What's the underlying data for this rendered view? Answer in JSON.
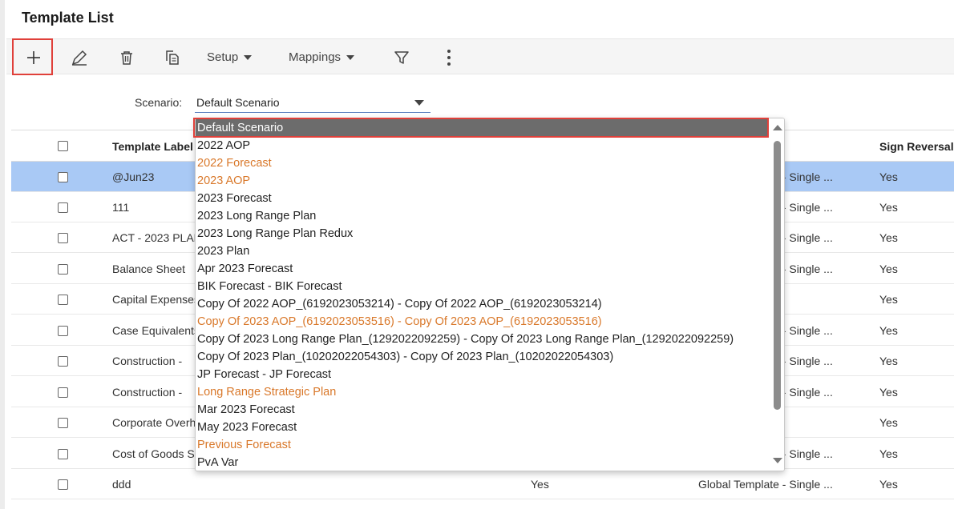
{
  "page": {
    "title": "Template List"
  },
  "toolbar": {
    "setup_label": "Setup",
    "mappings_label": "Mappings"
  },
  "scenario": {
    "label": "Scenario:",
    "value": "Default Scenario"
  },
  "table": {
    "columns": [
      {
        "label": ""
      },
      {
        "label": "Template Label"
      },
      {
        "label": "Sign Reversal"
      }
    ],
    "rows": [
      {
        "label": "@Jun23",
        "type": "Global Template - Single ...",
        "sign": "Yes",
        "selected": true
      },
      {
        "label": "111",
        "type": "Global Template - Single ...",
        "sign": "Yes"
      },
      {
        "label": "ACT - 2023 PLAN",
        "type": "Global Template - Single ...",
        "sign": "Yes"
      },
      {
        "label": "Balance Sheet",
        "type": "Global Template - Single ...",
        "sign": "Yes"
      },
      {
        "label": "Capital Expenses",
        "type": "Global Template",
        "sign": "Yes"
      },
      {
        "label": "Case Equivalents",
        "type": "Global Template - Single ...",
        "sign": "Yes"
      },
      {
        "label": "Construction - ",
        "type": "Global Template - Single ...",
        "sign": "Yes"
      },
      {
        "label": "Construction - ",
        "type": "Global Template - Single ...",
        "sign": "Yes"
      },
      {
        "label": "Corporate Overhead",
        "type": "Global Template",
        "sign": "Yes"
      },
      {
        "label": "Cost of Goods Sold",
        "type": "Global Template - Single ...",
        "sign": "Yes"
      },
      {
        "label": "ddd",
        "yes": "Yes",
        "type": "Global Template - Single ...",
        "sign": "Yes"
      }
    ]
  },
  "dropdown": {
    "options": [
      {
        "label": "Default Scenario",
        "selected": true
      },
      {
        "label": "2022 AOP"
      },
      {
        "label": "2022 Forecast",
        "highlight": true
      },
      {
        "label": "2023 AOP",
        "highlight": true
      },
      {
        "label": "2023 Forecast"
      },
      {
        "label": "2023 Long Range Plan"
      },
      {
        "label": "2023 Long Range Plan Redux"
      },
      {
        "label": "2023 Plan"
      },
      {
        "label": "Apr 2023 Forecast"
      },
      {
        "label": "BIK Forecast - BIK Forecast"
      },
      {
        "label": "Copy Of 2022 AOP_(6192023053214) - Copy Of 2022 AOP_(6192023053214)"
      },
      {
        "label": "Copy Of 2023 AOP_(6192023053516) - Copy Of 2023 AOP_(6192023053516)",
        "highlight": true
      },
      {
        "label": "Copy Of 2023 Long Range Plan_(1292022092259) - Copy Of 2023 Long Range Plan_(1292022092259)"
      },
      {
        "label": "Copy Of 2023 Plan_(10202022054303) - Copy Of 2023 Plan_(10202022054303)"
      },
      {
        "label": "JP Forecast - JP Forecast"
      },
      {
        "label": "Long Range Strategic Plan",
        "highlight": true
      },
      {
        "label": "Mar 2023 Forecast"
      },
      {
        "label": "May 2023 Forecast"
      },
      {
        "label": "Previous Forecast",
        "highlight": true
      },
      {
        "label": "PvA Var"
      }
    ]
  },
  "colors": {
    "highlight_text": "#d9782a",
    "selected_row": "#a9c9f5",
    "annotation_border": "#e0403a",
    "selected_option_bg": "#6c6c6c"
  }
}
